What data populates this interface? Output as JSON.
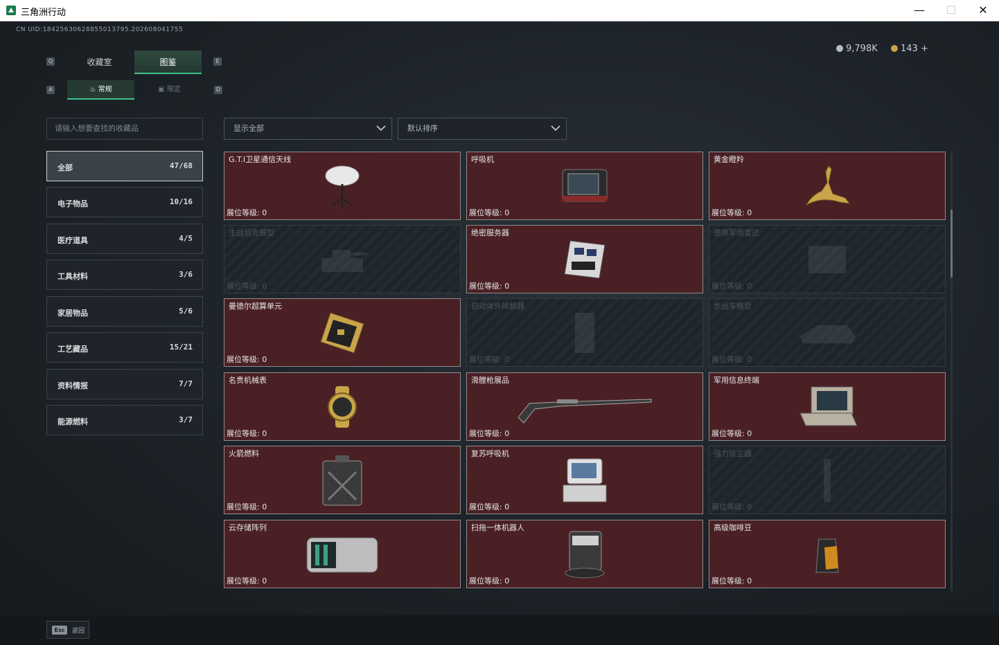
{
  "window": {
    "title": "三角洲行动",
    "minimize_glyph": "—",
    "maximize_glyph": "☐",
    "close_glyph": "✕"
  },
  "header": {
    "uid": "CN UID:18425630628855013795.202608041755",
    "currency": [
      {
        "icon": "silver-coin-icon",
        "value": "9,798K",
        "color": "#b8bec2"
      },
      {
        "icon": "gold-coin-icon",
        "value": "143 +",
        "color": "#c9a44a"
      }
    ]
  },
  "tabs": {
    "left_key": "Q",
    "right_key": "E",
    "items": [
      {
        "label": "收藏室",
        "active": false
      },
      {
        "label": "图鉴",
        "active": true
      }
    ]
  },
  "subtabs": {
    "left_key": "A",
    "right_key": "D",
    "items": [
      {
        "label": "常规",
        "icon": "flame-icon",
        "active": true
      },
      {
        "label": "限定",
        "icon": "image-icon",
        "active": false
      }
    ]
  },
  "search": {
    "placeholder": "请输入想要查找的收藏品"
  },
  "categories": [
    {
      "label": "全部",
      "count": "47/68",
      "active": true
    },
    {
      "label": "电子物品",
      "count": "10/16",
      "active": false
    },
    {
      "label": "医疗道具",
      "count": "4/5",
      "active": false
    },
    {
      "label": "工具材料",
      "count": "3/6",
      "active": false
    },
    {
      "label": "家居物品",
      "count": "5/6",
      "active": false
    },
    {
      "label": "工艺藏品",
      "count": "15/21",
      "active": false
    },
    {
      "label": "资料情报",
      "count": "7/7",
      "active": false
    },
    {
      "label": "能源燃料",
      "count": "3/7",
      "active": false
    }
  ],
  "filters": {
    "display": "显示全部",
    "sort": "默认排序"
  },
  "items": [
    {
      "name": "G.T.I卫星通信天线",
      "level": "展位等级: 0",
      "unlocked": true,
      "icon": "satellite-dish-icon"
    },
    {
      "name": "呼吸机",
      "level": "展位等级: 0",
      "unlocked": true,
      "icon": "ventilator-icon"
    },
    {
      "name": "黄金瞪羚",
      "level": "展位等级: 0",
      "unlocked": true,
      "icon": "gold-gazelle-icon"
    },
    {
      "name": "主战坦克模型",
      "level": "展位等级: 0",
      "unlocked": false,
      "icon": "tank-model-icon"
    },
    {
      "name": "绝密服务器",
      "level": "展位等级: 0",
      "unlocked": true,
      "icon": "server-icon"
    },
    {
      "name": "便携军用雷达",
      "level": "展位等级: 0",
      "unlocked": false,
      "icon": "radar-icon"
    },
    {
      "name": "曼德尔超算单元",
      "level": "展位等级: 0",
      "unlocked": true,
      "icon": "compute-unit-icon"
    },
    {
      "name": "自动体外除颤器",
      "level": "展位等级: 0",
      "unlocked": false,
      "icon": "defibrillator-icon"
    },
    {
      "name": "步战车模型",
      "level": "展位等级: 0",
      "unlocked": false,
      "icon": "ifv-model-icon"
    },
    {
      "name": "名贵机械表",
      "level": "展位等级: 0",
      "unlocked": true,
      "icon": "watch-icon"
    },
    {
      "name": "滑膛枪展品",
      "level": "展位等级: 0",
      "unlocked": true,
      "icon": "musket-icon"
    },
    {
      "name": "军用信息终端",
      "level": "展位等级: 0",
      "unlocked": true,
      "icon": "terminal-icon"
    },
    {
      "name": "火箭燃料",
      "level": "展位等级: 0",
      "unlocked": true,
      "icon": "fuel-can-icon"
    },
    {
      "name": "复苏呼吸机",
      "level": "展位等级: 0",
      "unlocked": true,
      "icon": "resuscitator-icon"
    },
    {
      "name": "强力吸尘器",
      "level": "展位等级: 0",
      "unlocked": false,
      "icon": "vacuum-icon"
    },
    {
      "name": "云存储阵列",
      "level": "展位等级: 0",
      "unlocked": true,
      "icon": "storage-array-icon"
    },
    {
      "name": "扫拖一体机器人",
      "level": "展位等级: 0",
      "unlocked": true,
      "icon": "robot-vacuum-icon"
    },
    {
      "name": "高级咖啡豆",
      "level": "展位等级: 0",
      "unlocked": true,
      "icon": "coffee-bag-icon"
    }
  ],
  "footer": {
    "esc_key": "Esc",
    "esc_label": "返回"
  }
}
